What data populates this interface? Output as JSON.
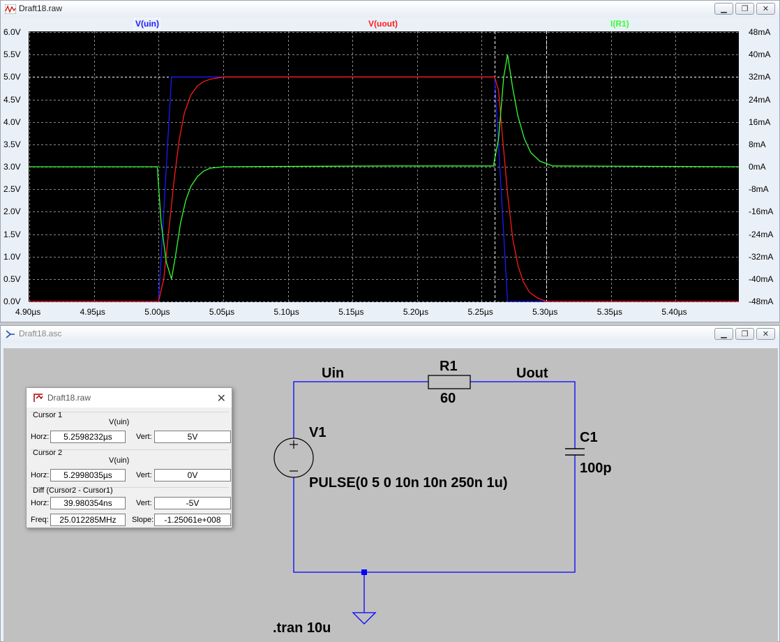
{
  "waveform_window": {
    "title": "Draft18.raw",
    "trace_labels": [
      {
        "text": "V(uin)",
        "color": "#1a1aff"
      },
      {
        "text": "V(uout)",
        "color": "#ff1a1a"
      },
      {
        "text": "I(R1)",
        "color": "#33ff33"
      }
    ],
    "y_left_ticks": [
      "6.0V",
      "5.5V",
      "5.0V",
      "4.5V",
      "4.0V",
      "3.5V",
      "3.0V",
      "2.5V",
      "2.0V",
      "1.5V",
      "1.0V",
      "0.5V",
      "0.0V"
    ],
    "y_right_ticks": [
      "48mA",
      "40mA",
      "32mA",
      "24mA",
      "16mA",
      "8mA",
      "0mA",
      "-8mA",
      "-16mA",
      "-24mA",
      "-32mA",
      "-40mA",
      "-48mA"
    ],
    "x_ticks": [
      "4.90µs",
      "4.95µs",
      "5.00µs",
      "5.05µs",
      "5.10µs",
      "5.15µs",
      "5.20µs",
      "5.25µs",
      "5.30µs",
      "5.35µs",
      "5.40µs"
    ]
  },
  "chart_data": {
    "type": "line",
    "x_unit": "µs",
    "xlim": [
      4.9,
      5.45
    ],
    "ylim_left": [
      0,
      6
    ],
    "ylim_right": [
      -48,
      48
    ],
    "cursors_x": [
      5.2598232,
      5.2998035
    ],
    "series": [
      {
        "name": "V(uin)",
        "color": "#1a1aff",
        "axis": "left",
        "x": [
          4.9,
          5.0,
          5.01,
          5.26,
          5.27,
          5.45
        ],
        "y": [
          0,
          0,
          5,
          5,
          0,
          0
        ]
      },
      {
        "name": "V(uout)",
        "color": "#ff1a1a",
        "axis": "left",
        "x": [
          4.9,
          5.0,
          5.004,
          5.008,
          5.012,
          5.016,
          5.02,
          5.025,
          5.03,
          5.035,
          5.04,
          5.05,
          5.26,
          5.263,
          5.266,
          5.27,
          5.274,
          5.278,
          5.282,
          5.287,
          5.293,
          5.3,
          5.45
        ],
        "y": [
          0,
          0,
          0.5,
          1.6,
          2.7,
          3.6,
          4.2,
          4.6,
          4.8,
          4.9,
          4.95,
          5,
          5,
          4.7,
          3.7,
          2.4,
          1.4,
          0.8,
          0.45,
          0.2,
          0.08,
          0,
          0
        ]
      },
      {
        "name": "I(R1)",
        "color": "#33ff33",
        "axis": "right",
        "x": [
          4.9,
          4.999,
          5.002,
          5.006,
          5.01,
          5.013,
          5.017,
          5.021,
          5.025,
          5.03,
          5.035,
          5.04,
          5.05,
          5.18,
          5.259,
          5.263,
          5.267,
          5.27,
          5.274,
          5.278,
          5.283,
          5.288,
          5.295,
          5.305,
          5.45
        ],
        "y": [
          0,
          0,
          -20,
          -34,
          -40,
          -32,
          -20,
          -12,
          -7,
          -3.5,
          -1.5,
          -0.5,
          0,
          0.3,
          0.3,
          10,
          32,
          40,
          28,
          18,
          10,
          5,
          2,
          0.3,
          0
        ]
      }
    ]
  },
  "schematic_window": {
    "title": "Draft18.asc",
    "labels": {
      "uin": "Uin",
      "uout": "Uout",
      "r1_name": "R1",
      "r1_value": "60",
      "v1_name": "V1",
      "v1_value": "PULSE(0 5 0 10n 10n 250n 1u)",
      "c1_name": "C1",
      "c1_value": "100p",
      "directive": ".tran 10u"
    },
    "wire_color": "#0000ff"
  },
  "cursor_dialog": {
    "title": "Draft18.raw",
    "cursor1": {
      "title": "Cursor 1",
      "signal": "V(uin)",
      "horz_label": "Horz:",
      "horz": "5.2598232µs",
      "vert_label": "Vert:",
      "vert": "5V"
    },
    "cursor2": {
      "title": "Cursor 2",
      "signal": "V(uin)",
      "horz_label": "Horz:",
      "horz": "5.2998035µs",
      "vert_label": "Vert:",
      "vert": "0V"
    },
    "diff": {
      "title": "Diff (Cursor2 - Cursor1)",
      "horz_label": "Horz:",
      "horz": "39.980354ns",
      "vert_label": "Vert:",
      "vert": "-5V",
      "freq_label": "Freq:",
      "freq": "25.012285MHz",
      "slope_label": "Slope:",
      "slope": "-1.25061e+008"
    }
  }
}
